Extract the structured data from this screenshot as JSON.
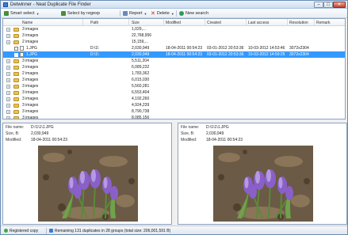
{
  "window": {
    "title": "Detwinner - Neat Duplicate File Finder",
    "controls": {
      "minimize": "–",
      "maximize": "□",
      "close": "✕"
    }
  },
  "toolbar": {
    "select_smart": "Smart select",
    "select_by_regexp": "Select by regexp",
    "report": "Report",
    "delete": "Delete",
    "new_search": "New search"
  },
  "list": {
    "columns": [
      "Name",
      "Path",
      "Size",
      "Modified",
      "Created",
      "Last access",
      "Resolution",
      "Remark"
    ],
    "rows": [
      {
        "type": "group",
        "name": "3 images",
        "size": "1,029,..."
      },
      {
        "type": "group",
        "name": "3 images",
        "size": "22,768,956"
      },
      {
        "type": "group",
        "name": "2 images",
        "size": "15,159,..."
      },
      {
        "type": "file",
        "name": "1.JPG",
        "path": "D:\\1\\",
        "size": "2,030,949",
        "modified": "18-04-2011 00:54:23",
        "created": "03-01-2012 20:53:36",
        "last_access": "10-03-2012 14:53:46",
        "resolution": "3072x2304"
      },
      {
        "type": "file",
        "selected": true,
        "name": "1.JPG",
        "path": "D:\\1\\",
        "size": "2,030,949",
        "modified": "18-04-2011 00:54:23",
        "created": "03-01-2012 20:53:36",
        "last_access": "10-03-2012 14:59:25",
        "resolution": "3072x2304"
      },
      {
        "type": "group",
        "name": "3 images",
        "size": "5,511,204"
      },
      {
        "type": "group",
        "name": "3 images",
        "size": "6,089,232"
      },
      {
        "type": "group",
        "name": "2 images",
        "size": "1,783,362"
      },
      {
        "type": "group",
        "name": "3 images",
        "size": "6,015,030"
      },
      {
        "type": "group",
        "name": "3 images",
        "size": "5,560,281"
      },
      {
        "type": "group",
        "name": "3 images",
        "size": "6,553,404"
      },
      {
        "type": "group",
        "name": "3 images",
        "size": "4,192,260"
      },
      {
        "type": "group",
        "name": "3 images",
        "size": "4,924,239"
      },
      {
        "type": "group",
        "name": "3 images",
        "size": "8,790,738"
      },
      {
        "type": "group",
        "name": "3 images",
        "size": "8,085,156"
      }
    ]
  },
  "preview_left": {
    "name_label": "File name:",
    "name": "D:\\1\\1\\1.JPG",
    "size_label": "Size, B:",
    "size": "2,030,949",
    "modified_label": "Modified:",
    "modified": "18-04-2011 00:54:23"
  },
  "preview_right": {
    "name_label": "File name:",
    "name": "D:\\1\\1\\1.JPG",
    "size_label": "Size, B:",
    "size": "2,030,949",
    "modified_label": "Modified:",
    "modified": "18-04-2011 00:54:23"
  },
  "status": {
    "registered": "Registered copy",
    "remaining": "Remaining 131 duplicates in 28 groups (total size: 206,001,591 B)"
  },
  "colors": {
    "selection": "#3399ff",
    "folder": "#e8c258",
    "flower": "#8a5fc8",
    "soil": "#6b5a45"
  },
  "icons": {
    "smart_select": "wand-icon",
    "select_by_regexp": "regexp-icon",
    "report": "report-icon",
    "delete": "delete-x-icon",
    "new_search": "new-search-icon",
    "registered": "check-icon",
    "remaining": "duplicate-icon"
  }
}
